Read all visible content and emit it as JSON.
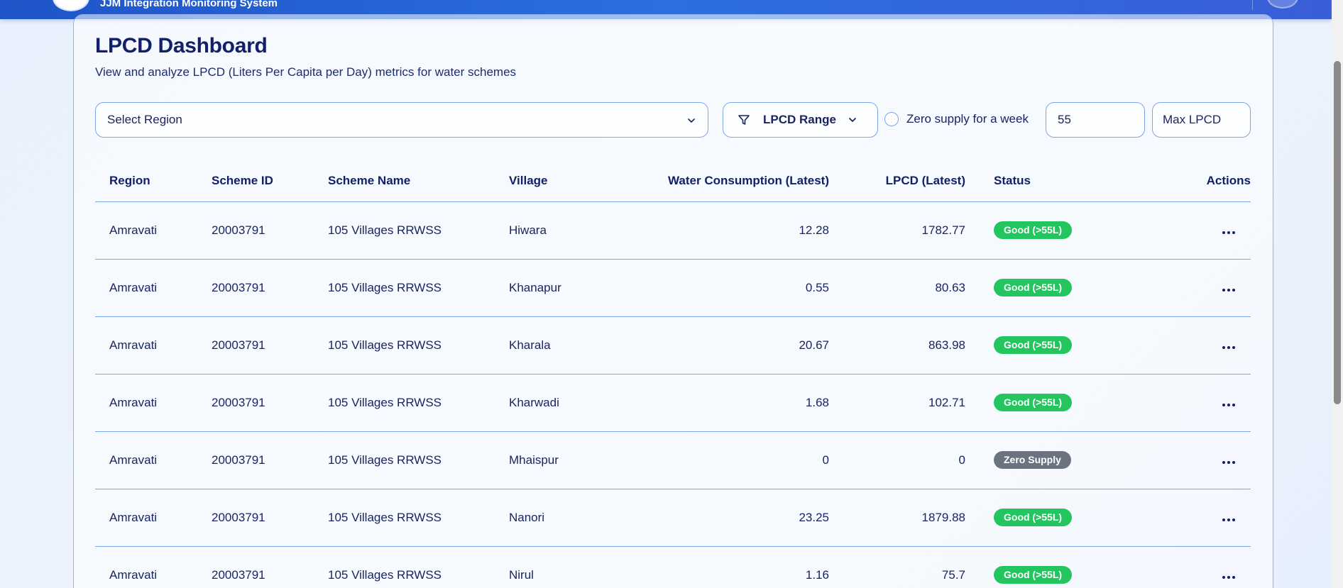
{
  "header": {
    "app_title": "JJM Integration Monitoring System"
  },
  "page": {
    "title": "LPCD Dashboard",
    "subtitle": "View and analyze LPCD (Liters Per Capita per Day) metrics for water schemes"
  },
  "filters": {
    "region_placeholder": "Select Region",
    "lpcd_range_label": "LPCD Range",
    "zero_supply_label": "Zero supply for a week",
    "min_lpcd_value": "55",
    "max_lpcd_placeholder": "Max LPCD"
  },
  "table": {
    "columns": {
      "region": "Region",
      "scheme_id": "Scheme ID",
      "scheme_name": "Scheme Name",
      "village": "Village",
      "water_consumption": "Water Consumption (Latest)",
      "lpcd": "LPCD (Latest)",
      "status": "Status",
      "actions": "Actions"
    },
    "rows": [
      {
        "region": "Amravati",
        "scheme_id": "20003791",
        "scheme_name": "105 Villages RRWSS",
        "village": "Hiwara",
        "water_consumption": "12.28",
        "lpcd": "1782.77",
        "status": "Good (>55L)",
        "status_type": "good"
      },
      {
        "region": "Amravati",
        "scheme_id": "20003791",
        "scheme_name": "105 Villages RRWSS",
        "village": "Khanapur",
        "water_consumption": "0.55",
        "lpcd": "80.63",
        "status": "Good (>55L)",
        "status_type": "good"
      },
      {
        "region": "Amravati",
        "scheme_id": "20003791",
        "scheme_name": "105 Villages RRWSS",
        "village": "Kharala",
        "water_consumption": "20.67",
        "lpcd": "863.98",
        "status": "Good (>55L)",
        "status_type": "good"
      },
      {
        "region": "Amravati",
        "scheme_id": "20003791",
        "scheme_name": "105 Villages RRWSS",
        "village": "Kharwadi",
        "water_consumption": "1.68",
        "lpcd": "102.71",
        "status": "Good (>55L)",
        "status_type": "good"
      },
      {
        "region": "Amravati",
        "scheme_id": "20003791",
        "scheme_name": "105 Villages RRWSS",
        "village": "Mhaispur",
        "water_consumption": "0",
        "lpcd": "0",
        "status": "Zero Supply",
        "status_type": "zero"
      },
      {
        "region": "Amravati",
        "scheme_id": "20003791",
        "scheme_name": "105 Villages RRWSS",
        "village": "Nanori",
        "water_consumption": "23.25",
        "lpcd": "1879.88",
        "status": "Good (>55L)",
        "status_type": "good"
      },
      {
        "region": "Amravati",
        "scheme_id": "20003791",
        "scheme_name": "105 Villages RRWSS",
        "village": "Nirul",
        "water_consumption": "1.16",
        "lpcd": "75.7",
        "status": "Good (>55L)",
        "status_type": "good"
      }
    ]
  },
  "colors": {
    "header_gradient_start": "#1e55c8",
    "header_gradient_end": "#3a5ed8",
    "status_good": "#22c55e",
    "status_zero": "#6b7280",
    "heading_text": "#12206b",
    "border": "#7ea6e6"
  },
  "icons": {
    "filter": "funnel-icon",
    "dropdown": "chevron-down-icon",
    "actions": "more-horizontal-icon"
  }
}
